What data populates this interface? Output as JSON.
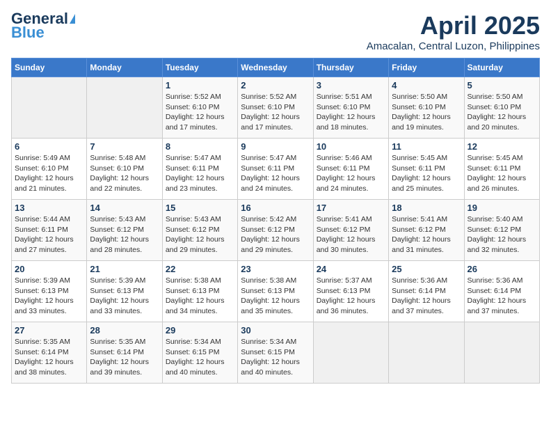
{
  "header": {
    "logo_line1": "General",
    "logo_line2": "Blue",
    "month": "April 2025",
    "location": "Amacalan, Central Luzon, Philippines"
  },
  "weekdays": [
    "Sunday",
    "Monday",
    "Tuesday",
    "Wednesday",
    "Thursday",
    "Friday",
    "Saturday"
  ],
  "weeks": [
    [
      {
        "day": "",
        "sunrise": "",
        "sunset": "",
        "daylight": ""
      },
      {
        "day": "",
        "sunrise": "",
        "sunset": "",
        "daylight": ""
      },
      {
        "day": "1",
        "sunrise": "Sunrise: 5:52 AM",
        "sunset": "Sunset: 6:10 PM",
        "daylight": "Daylight: 12 hours and 17 minutes."
      },
      {
        "day": "2",
        "sunrise": "Sunrise: 5:52 AM",
        "sunset": "Sunset: 6:10 PM",
        "daylight": "Daylight: 12 hours and 17 minutes."
      },
      {
        "day": "3",
        "sunrise": "Sunrise: 5:51 AM",
        "sunset": "Sunset: 6:10 PM",
        "daylight": "Daylight: 12 hours and 18 minutes."
      },
      {
        "day": "4",
        "sunrise": "Sunrise: 5:50 AM",
        "sunset": "Sunset: 6:10 PM",
        "daylight": "Daylight: 12 hours and 19 minutes."
      },
      {
        "day": "5",
        "sunrise": "Sunrise: 5:50 AM",
        "sunset": "Sunset: 6:10 PM",
        "daylight": "Daylight: 12 hours and 20 minutes."
      }
    ],
    [
      {
        "day": "6",
        "sunrise": "Sunrise: 5:49 AM",
        "sunset": "Sunset: 6:10 PM",
        "daylight": "Daylight: 12 hours and 21 minutes."
      },
      {
        "day": "7",
        "sunrise": "Sunrise: 5:48 AM",
        "sunset": "Sunset: 6:10 PM",
        "daylight": "Daylight: 12 hours and 22 minutes."
      },
      {
        "day": "8",
        "sunrise": "Sunrise: 5:47 AM",
        "sunset": "Sunset: 6:11 PM",
        "daylight": "Daylight: 12 hours and 23 minutes."
      },
      {
        "day": "9",
        "sunrise": "Sunrise: 5:47 AM",
        "sunset": "Sunset: 6:11 PM",
        "daylight": "Daylight: 12 hours and 24 minutes."
      },
      {
        "day": "10",
        "sunrise": "Sunrise: 5:46 AM",
        "sunset": "Sunset: 6:11 PM",
        "daylight": "Daylight: 12 hours and 24 minutes."
      },
      {
        "day": "11",
        "sunrise": "Sunrise: 5:45 AM",
        "sunset": "Sunset: 6:11 PM",
        "daylight": "Daylight: 12 hours and 25 minutes."
      },
      {
        "day": "12",
        "sunrise": "Sunrise: 5:45 AM",
        "sunset": "Sunset: 6:11 PM",
        "daylight": "Daylight: 12 hours and 26 minutes."
      }
    ],
    [
      {
        "day": "13",
        "sunrise": "Sunrise: 5:44 AM",
        "sunset": "Sunset: 6:11 PM",
        "daylight": "Daylight: 12 hours and 27 minutes."
      },
      {
        "day": "14",
        "sunrise": "Sunrise: 5:43 AM",
        "sunset": "Sunset: 6:12 PM",
        "daylight": "Daylight: 12 hours and 28 minutes."
      },
      {
        "day": "15",
        "sunrise": "Sunrise: 5:43 AM",
        "sunset": "Sunset: 6:12 PM",
        "daylight": "Daylight: 12 hours and 29 minutes."
      },
      {
        "day": "16",
        "sunrise": "Sunrise: 5:42 AM",
        "sunset": "Sunset: 6:12 PM",
        "daylight": "Daylight: 12 hours and 29 minutes."
      },
      {
        "day": "17",
        "sunrise": "Sunrise: 5:41 AM",
        "sunset": "Sunset: 6:12 PM",
        "daylight": "Daylight: 12 hours and 30 minutes."
      },
      {
        "day": "18",
        "sunrise": "Sunrise: 5:41 AM",
        "sunset": "Sunset: 6:12 PM",
        "daylight": "Daylight: 12 hours and 31 minutes."
      },
      {
        "day": "19",
        "sunrise": "Sunrise: 5:40 AM",
        "sunset": "Sunset: 6:12 PM",
        "daylight": "Daylight: 12 hours and 32 minutes."
      }
    ],
    [
      {
        "day": "20",
        "sunrise": "Sunrise: 5:39 AM",
        "sunset": "Sunset: 6:13 PM",
        "daylight": "Daylight: 12 hours and 33 minutes."
      },
      {
        "day": "21",
        "sunrise": "Sunrise: 5:39 AM",
        "sunset": "Sunset: 6:13 PM",
        "daylight": "Daylight: 12 hours and 33 minutes."
      },
      {
        "day": "22",
        "sunrise": "Sunrise: 5:38 AM",
        "sunset": "Sunset: 6:13 PM",
        "daylight": "Daylight: 12 hours and 34 minutes."
      },
      {
        "day": "23",
        "sunrise": "Sunrise: 5:38 AM",
        "sunset": "Sunset: 6:13 PM",
        "daylight": "Daylight: 12 hours and 35 minutes."
      },
      {
        "day": "24",
        "sunrise": "Sunrise: 5:37 AM",
        "sunset": "Sunset: 6:13 PM",
        "daylight": "Daylight: 12 hours and 36 minutes."
      },
      {
        "day": "25",
        "sunrise": "Sunrise: 5:36 AM",
        "sunset": "Sunset: 6:14 PM",
        "daylight": "Daylight: 12 hours and 37 minutes."
      },
      {
        "day": "26",
        "sunrise": "Sunrise: 5:36 AM",
        "sunset": "Sunset: 6:14 PM",
        "daylight": "Daylight: 12 hours and 37 minutes."
      }
    ],
    [
      {
        "day": "27",
        "sunrise": "Sunrise: 5:35 AM",
        "sunset": "Sunset: 6:14 PM",
        "daylight": "Daylight: 12 hours and 38 minutes."
      },
      {
        "day": "28",
        "sunrise": "Sunrise: 5:35 AM",
        "sunset": "Sunset: 6:14 PM",
        "daylight": "Daylight: 12 hours and 39 minutes."
      },
      {
        "day": "29",
        "sunrise": "Sunrise: 5:34 AM",
        "sunset": "Sunset: 6:15 PM",
        "daylight": "Daylight: 12 hours and 40 minutes."
      },
      {
        "day": "30",
        "sunrise": "Sunrise: 5:34 AM",
        "sunset": "Sunset: 6:15 PM",
        "daylight": "Daylight: 12 hours and 40 minutes."
      },
      {
        "day": "",
        "sunrise": "",
        "sunset": "",
        "daylight": ""
      },
      {
        "day": "",
        "sunrise": "",
        "sunset": "",
        "daylight": ""
      },
      {
        "day": "",
        "sunrise": "",
        "sunset": "",
        "daylight": ""
      }
    ]
  ]
}
